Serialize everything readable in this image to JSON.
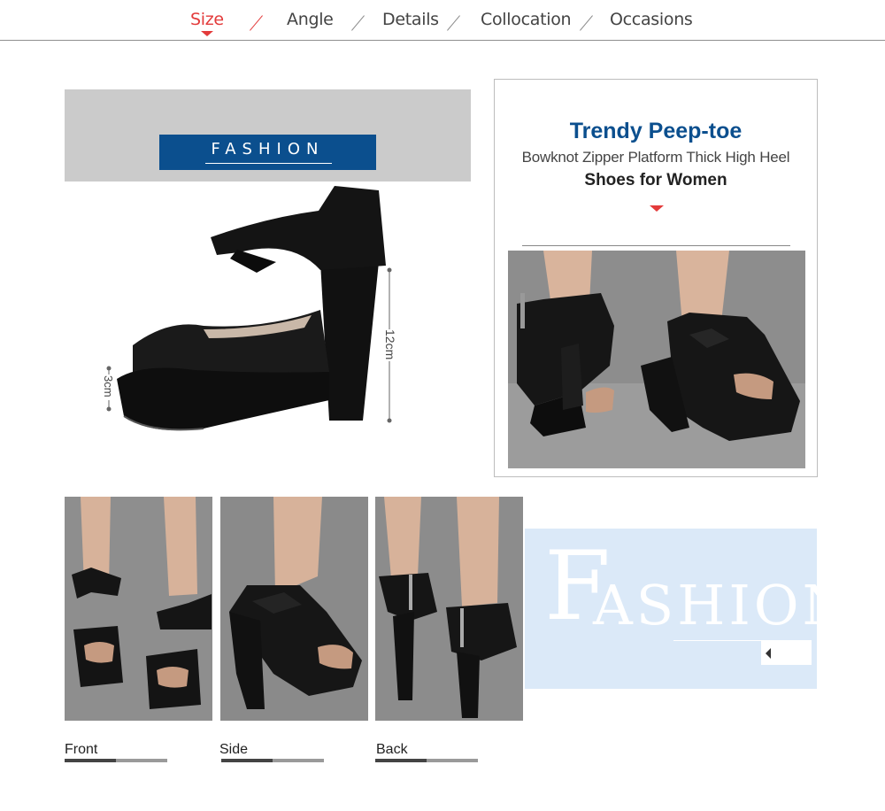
{
  "nav": {
    "items": [
      {
        "label": "Size",
        "active": true
      },
      {
        "label": "Angle",
        "active": false
      },
      {
        "label": "Details",
        "active": false
      },
      {
        "label": "Collocation",
        "active": false
      },
      {
        "label": "Occasions",
        "active": false
      }
    ],
    "accent_color": "#e33b3b"
  },
  "size_panel": {
    "badge_text": "FASHION",
    "badge_color": "#0b4f8e",
    "heel_height": "12cm",
    "platform_height": "3cm"
  },
  "headline": {
    "title": "Trendy Peep-toe",
    "subtitle": "Bowknot Zipper Platform Thick High Heel",
    "tagline": "Shoes for Women",
    "title_color": "#0b4f8e"
  },
  "views": [
    {
      "label": "Front",
      "bar_fill": 0.5
    },
    {
      "label": "Side",
      "bar_fill": 0.5
    },
    {
      "label": "Back",
      "bar_fill": 0.5
    }
  ],
  "fashion_panel": {
    "initial": "F",
    "rest": "ASHION",
    "icon": "arrow-left-icon"
  }
}
